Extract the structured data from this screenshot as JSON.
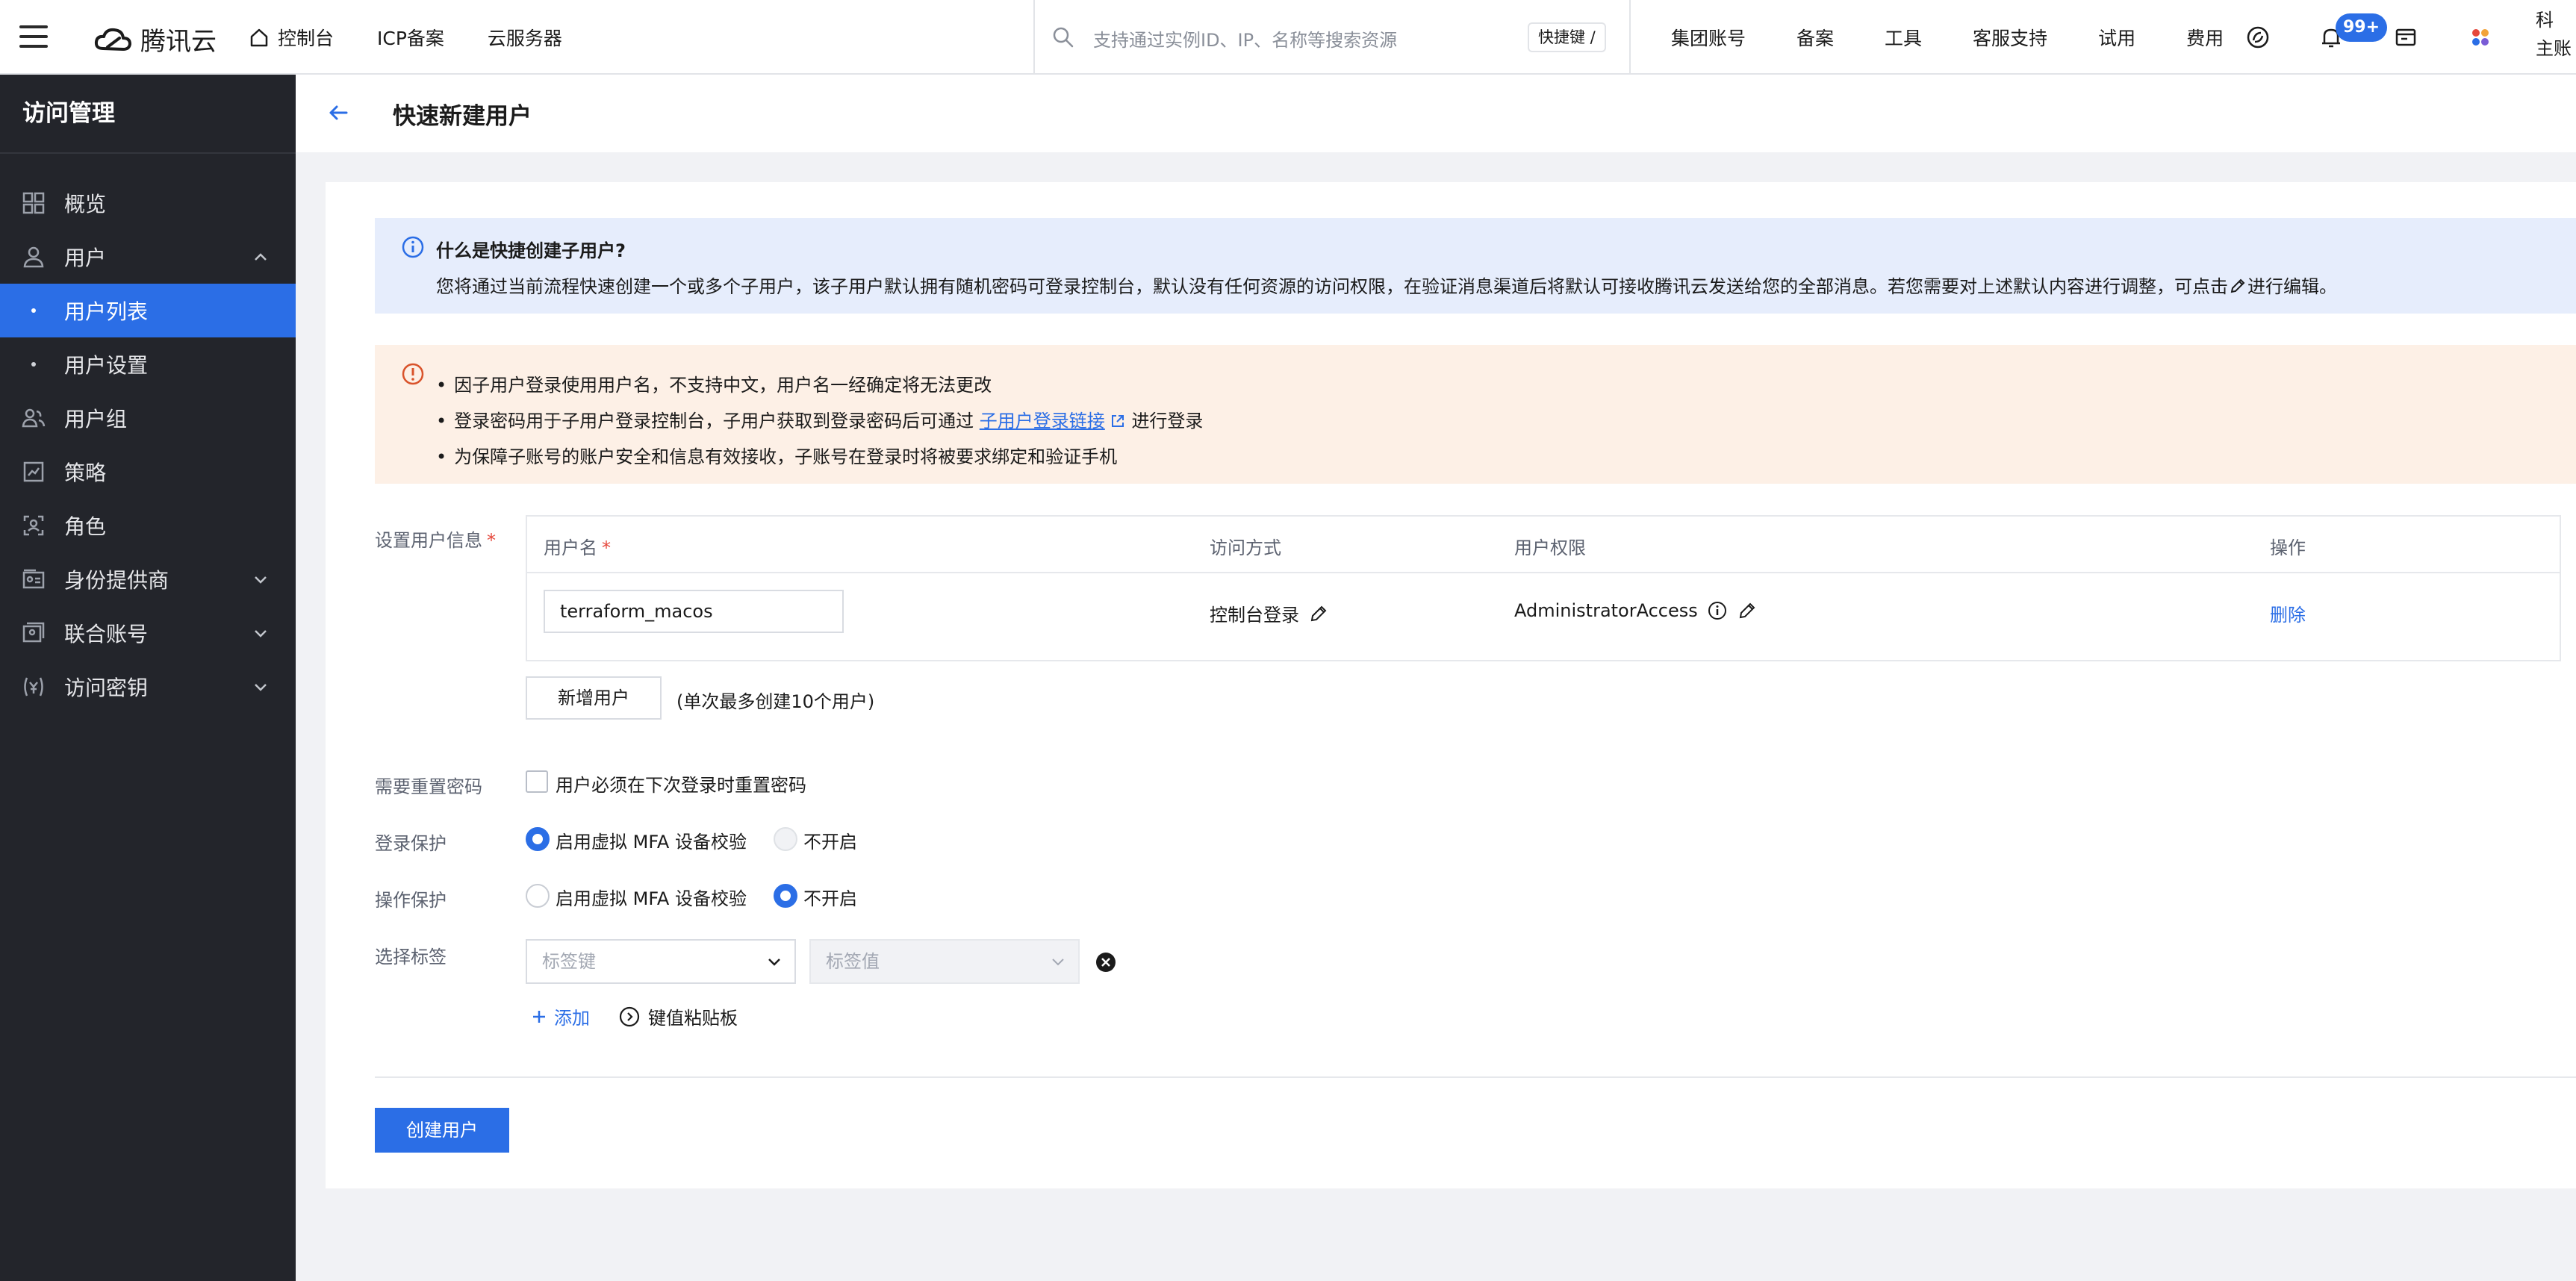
{
  "topbar": {
    "logo_text": "腾讯云",
    "nav": [
      "控制台",
      "ICP备案",
      "云服务器"
    ],
    "search_placeholder": "支持通过实例ID、IP、名称等搜索资源",
    "search_shortcut": "快捷键 /",
    "right_nav": [
      "集团账号",
      "备案",
      "工具",
      "客服支持",
      "试用",
      "费用"
    ],
    "notification_badge": "99+",
    "account_line1": "科",
    "account_line2": "主账"
  },
  "sidebar": {
    "title": "访问管理",
    "items": [
      {
        "label": "概览",
        "icon": "grid-icon"
      },
      {
        "label": "用户",
        "icon": "user-icon",
        "expanded": true
      },
      {
        "label": "用户列表",
        "sub": true,
        "active": true
      },
      {
        "label": "用户设置",
        "sub": true
      },
      {
        "label": "用户组",
        "icon": "user-group-icon"
      },
      {
        "label": "策略",
        "icon": "policy-icon"
      },
      {
        "label": "角色",
        "icon": "role-icon"
      },
      {
        "label": "身份提供商",
        "icon": "identity-provider-icon",
        "expanded": false
      },
      {
        "label": "联合账号",
        "icon": "federated-account-icon",
        "expanded": false
      },
      {
        "label": "访问密钥",
        "icon": "access-key-icon",
        "expanded": false
      }
    ]
  },
  "page": {
    "title": "快速新建用户"
  },
  "info": {
    "heading": "什么是快捷创建子用户?",
    "text_before": "您将通过当前流程快速创建一个或多个子用户，该子用户默认拥有随机密码可登录控制台，默认没有任何资源的访问权限，在验证消息渠道后将默认可接收腾讯云发送给您的全部消息。若您需要对上述默认内容进行调整，可点击",
    "text_after": "进行编辑。"
  },
  "warning": {
    "line1": "因子用户登录使用用户名，不支持中文，用户名一经确定将无法更改",
    "line2_before": "登录密码用于子用户登录控制台，子用户获取到登录密码后可通过",
    "line2_link": "子用户登录链接",
    "line2_after": "进行登录",
    "line3": "为保障子账号的账户安全和信息有效接收，子账号在登录时将被要求绑定和验证手机"
  },
  "form": {
    "user_info_label": "设置用户信息",
    "required_mark": "*",
    "table_headers": {
      "username": "用户名",
      "access_method": "访问方式",
      "permission": "用户权限",
      "action": "操作"
    },
    "rows": [
      {
        "username": "terraform_macos",
        "access_method": "控制台登录",
        "permission": "AdministratorAccess",
        "action": "删除"
      }
    ],
    "add_user_button": "新增用户",
    "add_user_hint": "(单次最多创建10个用户)",
    "reset_password_label": "需要重置密码",
    "reset_password_checkbox": "用户必须在下次登录时重置密码",
    "reset_password_checked": false,
    "login_protection_label": "登录保护",
    "login_protection_options": [
      "启用虚拟 MFA 设备校验",
      "不开启"
    ],
    "login_protection_selected": "启用虚拟 MFA 设备校验",
    "operation_protection_label": "操作保护",
    "operation_protection_options": [
      "启用虚拟 MFA 设备校验",
      "不开启"
    ],
    "operation_protection_selected": "不开启",
    "tag_label": "选择标签",
    "tag_key_placeholder": "标签键",
    "tag_value_placeholder": "标签值",
    "add_tag": "添加",
    "paste_tags": "键值粘贴板",
    "submit_button": "创建用户"
  },
  "colors": {
    "accent": "#2b6ee6",
    "sidebar_bg": "#23252b",
    "info_bg": "#e6edfc",
    "warning_bg": "#fdf0e6"
  }
}
